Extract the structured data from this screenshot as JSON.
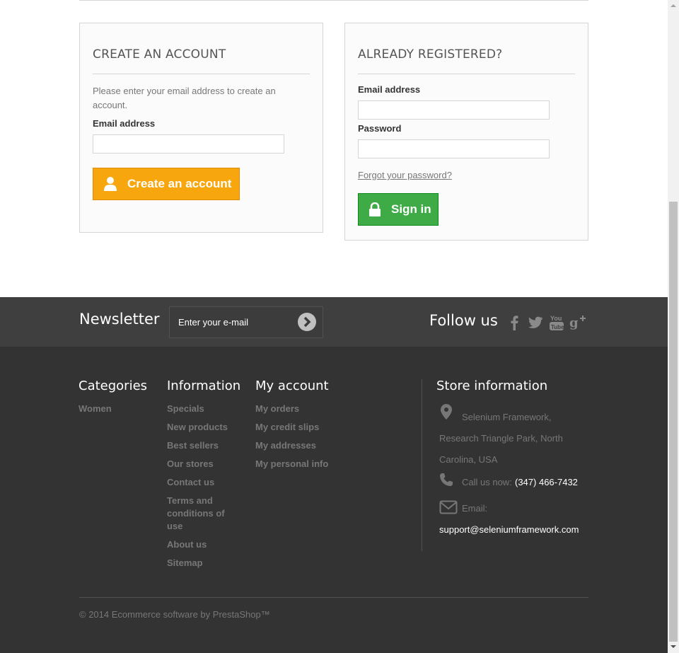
{
  "create_account": {
    "title": "CREATE AN ACCOUNT",
    "intro": "Please enter your email address to create an account.",
    "email_label": "Email address",
    "email_value": "",
    "button_label": "Create an account"
  },
  "login": {
    "title": "ALREADY REGISTERED?",
    "email_label": "Email address",
    "email_value": "",
    "password_label": "Password",
    "password_value": "",
    "forgot_link": "Forgot your password?",
    "button_label": "Sign in"
  },
  "newsletter": {
    "title": "Newsletter",
    "placeholder": "Enter your e-mail",
    "submit_icon": "chevron-right-circle-icon"
  },
  "follow": {
    "title": "Follow us",
    "icons": [
      "facebook-icon",
      "twitter-icon",
      "youtube-icon",
      "google-plus-icon"
    ]
  },
  "footer": {
    "categories": {
      "title": "Categories",
      "items": [
        "Women"
      ]
    },
    "information": {
      "title": "Information",
      "items": [
        "Specials",
        "New products",
        "Best sellers",
        "Our stores",
        "Contact us",
        "Terms and conditions of use",
        "About us",
        "Sitemap"
      ]
    },
    "my_account": {
      "title": "My account",
      "items": [
        "My orders",
        "My credit slips",
        "My addresses",
        "My personal info"
      ]
    },
    "store": {
      "title": "Store information",
      "address": "Selenium Framework, Research Triangle Park, North Carolina, USA",
      "call_label": "Call us now:",
      "phone": "(347) 466-7432",
      "email_label": "Email:",
      "email": "support@seleniumframework.com"
    },
    "copyright": "© 2014 Ecommerce software by PrestaShop™"
  },
  "colors": {
    "create_button": "#f7a60d",
    "signin_button": "#3fab46",
    "footer_bg": "#333333",
    "newsletter_bg": "#3f3f3f"
  }
}
